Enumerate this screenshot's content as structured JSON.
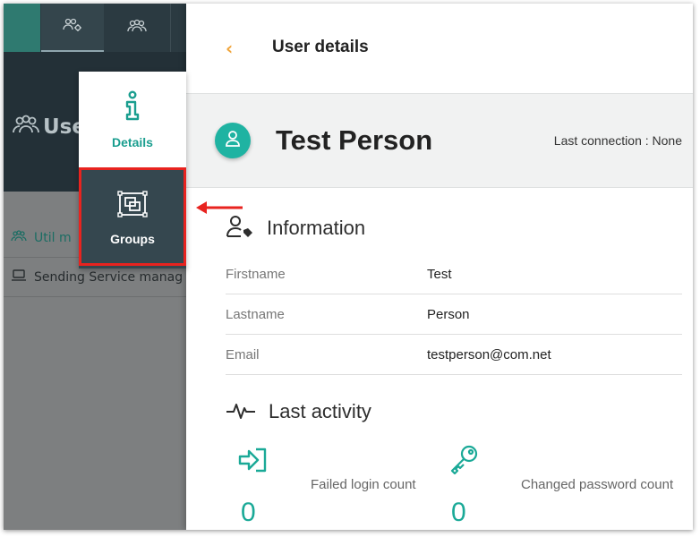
{
  "topbar": {
    "tabs": [
      {
        "icon": "users-gear-icon"
      },
      {
        "icon": "users-icon"
      }
    ]
  },
  "left_header": {
    "title": "Use"
  },
  "left_list": {
    "items": [
      {
        "label": "Util m",
        "icon": "users-icon"
      },
      {
        "label": "Sending Service manag",
        "icon": "monitor-icon"
      }
    ]
  },
  "popup_menu": {
    "details_label": "Details",
    "groups_label": "Groups"
  },
  "panel": {
    "back_glyph": "‹",
    "title": "User details",
    "user_name": "Test Person",
    "last_connection": "Last connection : None"
  },
  "information": {
    "heading": "Information",
    "rows": [
      {
        "label": "Firstname",
        "value": "Test"
      },
      {
        "label": "Lastname",
        "value": "Person"
      },
      {
        "label": "Email",
        "value": "testperson@com.net"
      }
    ]
  },
  "activity": {
    "heading": "Last activity",
    "stats": [
      {
        "label": "Failed login count",
        "value": "0",
        "icon": "login-icon"
      },
      {
        "label": "Changed password count",
        "value": "0",
        "icon": "key-icon"
      }
    ]
  },
  "colors": {
    "accent_teal": "#1fb3a2",
    "back_orange": "#f0a43a",
    "highlight_red": "#e8231f",
    "dark_bar": "#2b3a41"
  }
}
